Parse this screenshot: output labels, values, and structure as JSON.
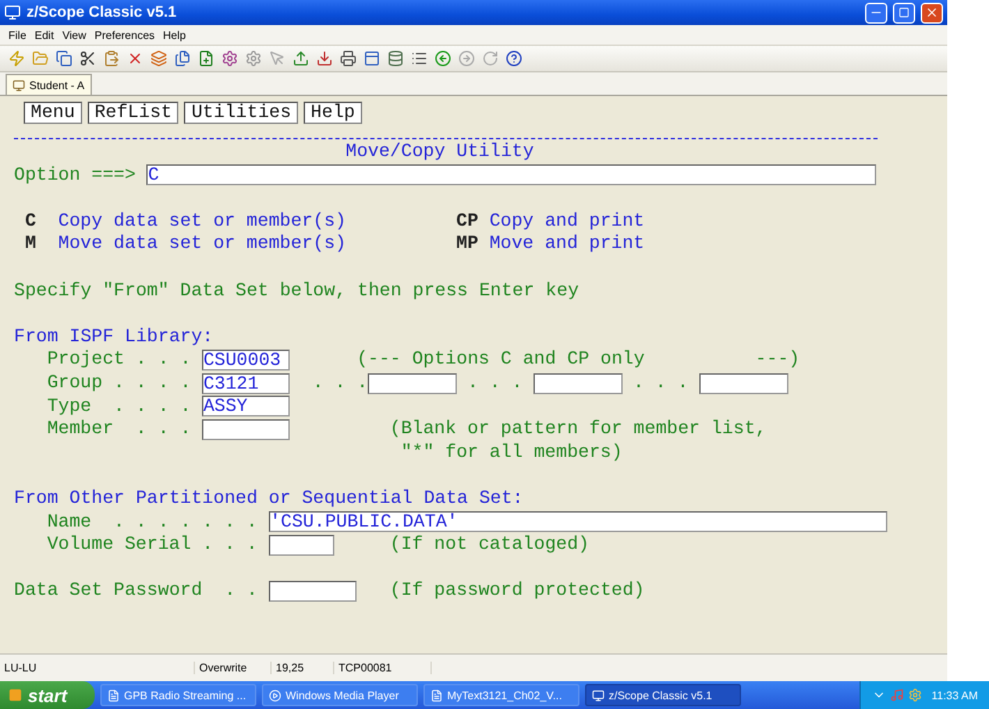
{
  "window": {
    "title": "z/Scope Classic v5.1"
  },
  "menu": [
    "File",
    "Edit",
    "View",
    "Preferences",
    "Help"
  ],
  "session_tab": {
    "label": "Student - A"
  },
  "terminal": {
    "action_bar": [
      "Menu",
      "RefList",
      "Utilities",
      "Help"
    ],
    "title": "Move/Copy Utility",
    "option": {
      "label": "Option ===>",
      "value": "C"
    },
    "commands": [
      {
        "code": "C",
        "text": "Copy data set or member(s)"
      },
      {
        "code": "CP",
        "text": "Copy and print"
      },
      {
        "code": "M",
        "text": "Move data set or member(s)"
      },
      {
        "code": "MP",
        "text": "Move and print"
      }
    ],
    "instruction": "Specify \"From\" Data Set below, then press Enter key",
    "library": {
      "heading": "From ISPF Library:",
      "fields": [
        {
          "label": "Project . . .",
          "value": "CSU0003",
          "note": "(--- Options C and CP only          ---)"
        },
        {
          "label": "Group . . . .",
          "value": "C3121",
          "more": [
            ". . .",
            ". . .",
            ". . ."
          ]
        },
        {
          "label": "Type  . . . .",
          "value": "ASSY"
        },
        {
          "label": "Member  . . .",
          "note": "(Blank or pattern for member list,",
          "note_2": "\"*\" for all members)"
        }
      ]
    },
    "other": {
      "heading": "From Other Partitioned or Sequential Data Set:",
      "fields": [
        {
          "label": "Name  . . . . . . .",
          "value": "'CSU.PUBLIC.DATA'"
        },
        {
          "label": "Volume Serial . . .",
          "note": "(If not cataloged)"
        }
      ]
    },
    "password": {
      "label": "Data Set Password  . .",
      "note": "(If password protected)"
    }
  },
  "status_bar": [
    "LU-LU",
    "Overwrite",
    "19,25",
    "TCP00081"
  ],
  "taskbar": {
    "start": "start",
    "tasks": [
      {
        "label": "GPB Radio Streaming ...",
        "selected": false
      },
      {
        "label": "Windows Media Player",
        "selected": false
      },
      {
        "label": "MyText3121_Ch02_V...",
        "selected": false
      },
      {
        "label": "z/Scope Classic v5.1",
        "selected": true
      }
    ],
    "clock": "11:33 AM"
  }
}
